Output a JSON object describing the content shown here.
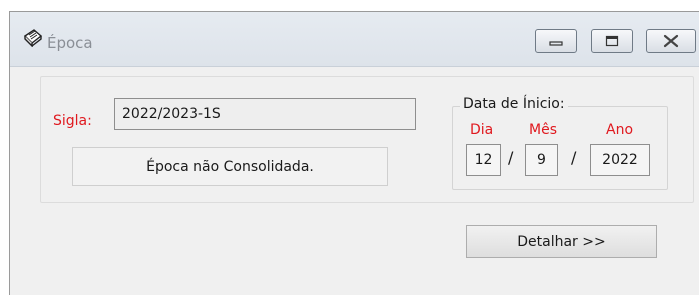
{
  "window": {
    "title": "Época",
    "icon": "notepad-pencil-icon",
    "controls": {
      "minimize": "minimize-icon",
      "maximize": "maximize-icon",
      "close": "close-icon"
    }
  },
  "form": {
    "sigla_label": "Sigla:",
    "sigla_value": "2022/2023-1S",
    "status": "Época não Consolidada."
  },
  "start_date": {
    "legend": "Data de Ínicio:",
    "day_label": "Dia",
    "month_label": "Mês",
    "year_label": "Ano",
    "day": "12",
    "month": "9",
    "year": "2022",
    "separator": "/"
  },
  "actions": {
    "detail_label": "Detalhar >>"
  },
  "colors": {
    "label_red": "#e0191f",
    "window_bg": "#f0f0f0"
  }
}
